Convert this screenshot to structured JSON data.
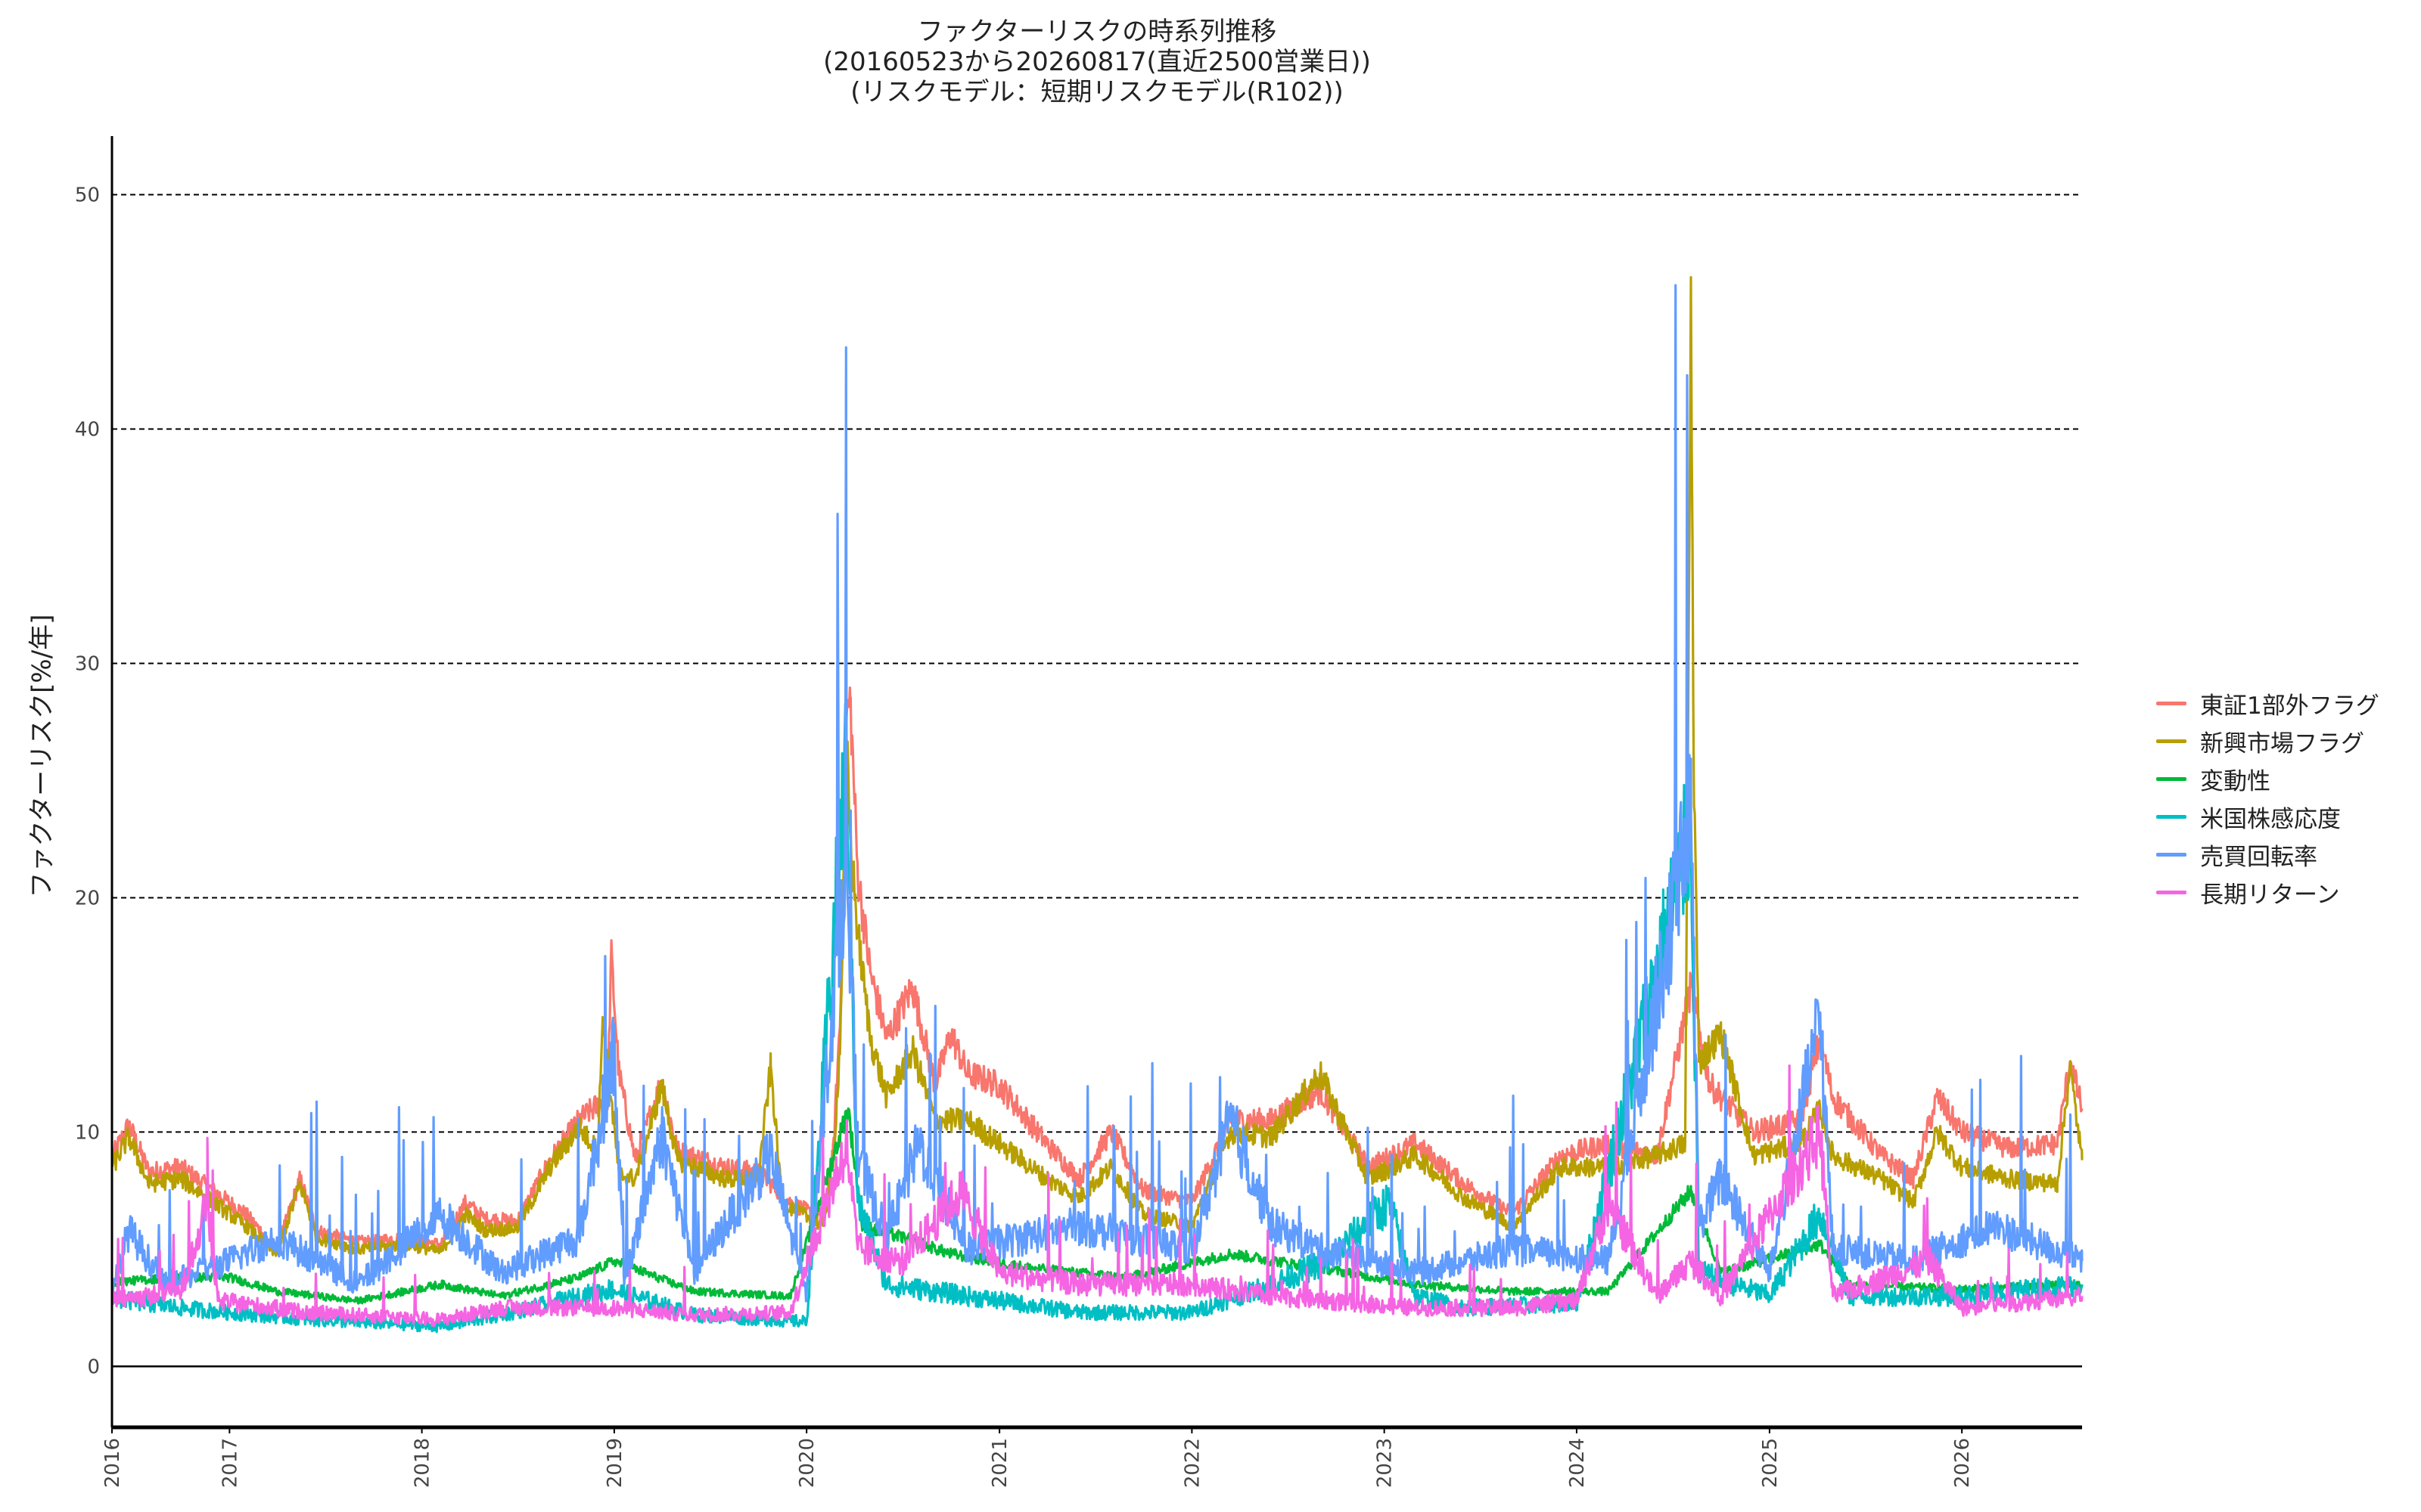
{
  "title": {
    "line1": "ファクターリスクの時系列推移",
    "line2": "(20160523から20260817(直近2500営業日))",
    "line3": "(リスクモデル：短期リスクモデル(R102))"
  },
  "chart_data": {
    "type": "line",
    "title": "ファクターリスクの時系列推移 (20160523から20260817(直近2500営業日)) (リスクモデル：短期リスクモデル(R102))",
    "xlabel": "",
    "ylabel": "ファクターリスク[%/年]",
    "xlim": [
      "2016-05-23",
      "2026-08-17"
    ],
    "ylim": [
      -2.6,
      52.5
    ],
    "yticks": [
      0,
      10,
      20,
      30,
      40,
      50
    ],
    "xticks": [
      "2016",
      "2017",
      "2018",
      "2019",
      "2020",
      "2021",
      "2022",
      "2023",
      "2024",
      "2025",
      "2026"
    ],
    "grid": "horizontal dashed",
    "legend_position": "right",
    "series": [
      {
        "name": "東証1部外フラグ",
        "color": "#F8766D",
        "points": [
          [
            "2016-05-23",
            8.9
          ],
          [
            "2016-06-24",
            10.3
          ],
          [
            "2016-08-01",
            8.3
          ],
          [
            "2016-10-01",
            8.5
          ],
          [
            "2016-12-01",
            7.5
          ],
          [
            "2017-02-01",
            6.5
          ],
          [
            "2017-04-01",
            5.0
          ],
          [
            "2017-05-15",
            8.0
          ],
          [
            "2017-06-15",
            5.8
          ],
          [
            "2017-09-01",
            5.3
          ],
          [
            "2017-12-01",
            5.5
          ],
          [
            "2018-02-06",
            5.2
          ],
          [
            "2018-03-25",
            7.0
          ],
          [
            "2018-05-01",
            6.3
          ],
          [
            "2018-07-01",
            6.2
          ],
          [
            "2018-09-01",
            8.8
          ],
          [
            "2018-10-26",
            10.5
          ],
          [
            "2018-12-20",
            11.5
          ],
          [
            "2018-12-26",
            17.6
          ],
          [
            "2019-01-10",
            12.5
          ],
          [
            "2019-02-10",
            8.8
          ],
          [
            "2019-04-01",
            12.2
          ],
          [
            "2019-05-01",
            9.2
          ],
          [
            "2019-08-01",
            8.5
          ],
          [
            "2019-10-01",
            8.3
          ],
          [
            "2019-12-01",
            7.0
          ],
          [
            "2020-02-01",
            6.3
          ],
          [
            "2020-02-20",
            9.0
          ],
          [
            "2020-03-05",
            15.0
          ],
          [
            "2020-03-17",
            27.8
          ],
          [
            "2020-03-24",
            28.4
          ],
          [
            "2020-04-07",
            21.0
          ],
          [
            "2020-05-01",
            16.8
          ],
          [
            "2020-06-01",
            14.0
          ],
          [
            "2020-07-20",
            16.2
          ],
          [
            "2020-09-01",
            12.0
          ],
          [
            "2020-10-01",
            14.2
          ],
          [
            "2020-11-01",
            12.5
          ],
          [
            "2021-01-01",
            12.0
          ],
          [
            "2021-04-01",
            9.5
          ],
          [
            "2021-06-01",
            8.0
          ],
          [
            "2021-08-01",
            10.0
          ],
          [
            "2021-10-01",
            7.5
          ],
          [
            "2022-01-01",
            7.0
          ],
          [
            "2022-03-15",
            10.5
          ],
          [
            "2022-06-01",
            10.5
          ],
          [
            "2022-09-01",
            11.8
          ],
          [
            "2022-12-01",
            8.5
          ],
          [
            "2023-03-01",
            9.5
          ],
          [
            "2023-06-01",
            7.8
          ],
          [
            "2023-09-01",
            6.5
          ],
          [
            "2023-12-01",
            9.0
          ],
          [
            "2024-03-01",
            9.5
          ],
          [
            "2024-06-01",
            9.0
          ],
          [
            "2024-08-05",
            16.2
          ],
          [
            "2024-09-10",
            12.0
          ],
          [
            "2024-12-01",
            10.0
          ],
          [
            "2025-03-01",
            10.5
          ],
          [
            "2025-04-07",
            14.0
          ],
          [
            "2025-05-01",
            11.5
          ],
          [
            "2025-08-01",
            9.0
          ],
          [
            "2025-10-01",
            8.0
          ],
          [
            "2025-11-15",
            11.5
          ],
          [
            "2026-01-01",
            10.0
          ],
          [
            "2026-04-01",
            9.3
          ],
          [
            "2026-07-01",
            9.5
          ],
          [
            "2026-07-25",
            13.0
          ],
          [
            "2026-08-17",
            11.0
          ]
        ]
      },
      {
        "name": "新興市場フラグ",
        "color": "#B79F00",
        "points": [
          [
            "2016-05-23",
            8.5
          ],
          [
            "2016-06-24",
            9.8
          ],
          [
            "2016-08-01",
            7.8
          ],
          [
            "2016-10-01",
            8.0
          ],
          [
            "2016-12-01",
            7.0
          ],
          [
            "2017-02-01",
            6.0
          ],
          [
            "2017-04-01",
            4.8
          ],
          [
            "2017-05-15",
            7.8
          ],
          [
            "2017-06-15",
            5.5
          ],
          [
            "2017-09-01",
            5.0
          ],
          [
            "2017-12-01",
            5.2
          ],
          [
            "2018-02-06",
            4.9
          ],
          [
            "2018-03-25",
            6.5
          ],
          [
            "2018-05-01",
            5.8
          ],
          [
            "2018-07-01",
            5.9
          ],
          [
            "2018-09-01",
            8.5
          ],
          [
            "2018-10-26",
            10.2
          ],
          [
            "2018-12-01",
            9.2
          ],
          [
            "2018-12-10",
            14.9
          ],
          [
            "2019-01-10",
            8.2
          ],
          [
            "2019-02-10",
            8.0
          ],
          [
            "2019-04-01",
            12.0
          ],
          [
            "2019-05-01",
            8.8
          ],
          [
            "2019-08-01",
            8.0
          ],
          [
            "2019-10-01",
            8.0
          ],
          [
            "2019-10-25",
            12.8
          ],
          [
            "2019-11-15",
            7.0
          ],
          [
            "2020-02-01",
            6.0
          ],
          [
            "2020-02-20",
            8.5
          ],
          [
            "2020-03-05",
            14.0
          ],
          [
            "2020-03-17",
            26.5
          ],
          [
            "2020-03-24",
            22.5
          ],
          [
            "2020-04-07",
            18.5
          ],
          [
            "2020-05-01",
            14.0
          ],
          [
            "2020-06-01",
            11.5
          ],
          [
            "2020-07-20",
            13.5
          ],
          [
            "2020-09-01",
            10.5
          ],
          [
            "2020-11-01",
            10.5
          ],
          [
            "2021-01-01",
            9.5
          ],
          [
            "2021-04-01",
            8.0
          ],
          [
            "2021-06-01",
            7.2
          ],
          [
            "2021-08-01",
            8.5
          ],
          [
            "2021-10-01",
            6.5
          ],
          [
            "2022-01-01",
            6.0
          ],
          [
            "2022-03-15",
            10.0
          ],
          [
            "2022-06-01",
            9.8
          ],
          [
            "2022-09-01",
            12.5
          ],
          [
            "2022-12-01",
            8.0
          ],
          [
            "2023-03-01",
            9.0
          ],
          [
            "2023-06-01",
            7.2
          ],
          [
            "2023-09-01",
            6.0
          ],
          [
            "2023-12-01",
            8.5
          ],
          [
            "2024-03-01",
            8.5
          ],
          [
            "2024-06-01",
            9.0
          ],
          [
            "2024-07-25",
            9.5
          ],
          [
            "2024-08-05",
            45.5
          ],
          [
            "2024-08-10",
            26.0
          ],
          [
            "2024-08-20",
            13.0
          ],
          [
            "2024-10-01",
            14.2
          ],
          [
            "2024-12-01",
            9.0
          ],
          [
            "2025-03-01",
            9.5
          ],
          [
            "2025-04-07",
            11.0
          ],
          [
            "2025-05-01",
            9.0
          ],
          [
            "2025-08-01",
            8.0
          ],
          [
            "2025-10-01",
            7.0
          ],
          [
            "2025-11-15",
            10.0
          ],
          [
            "2026-01-01",
            8.5
          ],
          [
            "2026-04-01",
            8.0
          ],
          [
            "2026-07-01",
            7.8
          ],
          [
            "2026-07-25",
            12.8
          ],
          [
            "2026-08-17",
            8.8
          ]
        ]
      },
      {
        "name": "変動性",
        "color": "#00BA38",
        "points": [
          [
            "2016-05-23",
            3.6
          ],
          [
            "2016-10-01",
            3.8
          ],
          [
            "2017-01-01",
            3.8
          ],
          [
            "2017-04-01",
            3.2
          ],
          [
            "2017-09-01",
            2.8
          ],
          [
            "2018-02-06",
            3.5
          ],
          [
            "2018-06-01",
            3.0
          ],
          [
            "2018-10-26",
            3.8
          ],
          [
            "2019-01-01",
            4.5
          ],
          [
            "2019-06-01",
            3.2
          ],
          [
            "2019-12-01",
            3.0
          ],
          [
            "2020-03-20",
            11.0
          ],
          [
            "2020-04-15",
            6.0
          ],
          [
            "2020-07-01",
            5.5
          ],
          [
            "2020-10-01",
            4.8
          ],
          [
            "2021-03-01",
            4.2
          ],
          [
            "2021-09-01",
            3.8
          ],
          [
            "2022-03-15",
            4.8
          ],
          [
            "2022-09-01",
            4.2
          ],
          [
            "2023-03-01",
            3.5
          ],
          [
            "2023-09-01",
            3.2
          ],
          [
            "2024-03-01",
            3.2
          ],
          [
            "2024-08-05",
            7.5
          ],
          [
            "2024-10-01",
            4.0
          ],
          [
            "2025-04-07",
            5.2
          ],
          [
            "2025-06-01",
            3.5
          ],
          [
            "2026-01-01",
            3.3
          ],
          [
            "2026-08-17",
            3.5
          ]
        ]
      },
      {
        "name": "米国株感応度",
        "color": "#00BFC4",
        "points": [
          [
            "2016-05-23",
            2.9
          ],
          [
            "2016-10-01",
            2.5
          ],
          [
            "2017-01-01",
            2.3
          ],
          [
            "2017-06-01",
            2.0
          ],
          [
            "2018-02-06",
            1.7
          ],
          [
            "2018-06-01",
            2.2
          ],
          [
            "2018-12-26",
            3.3
          ],
          [
            "2019-06-01",
            2.2
          ],
          [
            "2020-01-01",
            1.9
          ],
          [
            "2020-03-17",
            26.3
          ],
          [
            "2020-04-07",
            7.0
          ],
          [
            "2020-06-01",
            3.5
          ],
          [
            "2021-01-01",
            2.8
          ],
          [
            "2021-06-01",
            2.3
          ],
          [
            "2022-01-01",
            2.3
          ],
          [
            "2022-06-01",
            3.5
          ],
          [
            "2022-09-15",
            4.5
          ],
          [
            "2023-01-10",
            7.0
          ],
          [
            "2023-03-01",
            3.0
          ],
          [
            "2023-06-01",
            2.5
          ],
          [
            "2024-01-01",
            2.7
          ],
          [
            "2024-08-05",
            23.0
          ],
          [
            "2024-08-20",
            4.0
          ],
          [
            "2025-01-01",
            3.0
          ],
          [
            "2025-04-07",
            6.5
          ],
          [
            "2025-06-01",
            3.0
          ],
          [
            "2026-01-01",
            3.0
          ],
          [
            "2026-08-17",
            3.5
          ]
        ]
      },
      {
        "name": "売買回転率",
        "color": "#619CFF",
        "points": [
          [
            "2016-05-23",
            3.2
          ],
          [
            "2016-06-24",
            5.8
          ],
          [
            "2016-09-01",
            3.5
          ],
          [
            "2017-01-01",
            4.5
          ],
          [
            "2017-04-01",
            5.5
          ],
          [
            "2017-09-01",
            3.5
          ],
          [
            "2018-02-06",
            6.5
          ],
          [
            "2018-06-01",
            4.0
          ],
          [
            "2018-10-26",
            5.5
          ],
          [
            "2019-01-01",
            13.5
          ],
          [
            "2019-01-20",
            3.5
          ],
          [
            "2019-04-01",
            10.0
          ],
          [
            "2019-06-01",
            4.0
          ],
          [
            "2019-10-25",
            9.0
          ],
          [
            "2020-01-01",
            3.0
          ],
          [
            "2020-03-17",
            22.0
          ],
          [
            "2020-04-07",
            9.0
          ],
          [
            "2020-06-01",
            5.5
          ],
          [
            "2020-08-01",
            9.5
          ],
          [
            "2020-11-01",
            5.0
          ],
          [
            "2021-06-01",
            6.0
          ],
          [
            "2022-01-01",
            5.0
          ],
          [
            "2022-03-15",
            10.5
          ],
          [
            "2022-06-01",
            6.0
          ],
          [
            "2022-09-01",
            5.0
          ],
          [
            "2023-03-01",
            4.0
          ],
          [
            "2023-09-01",
            5.0
          ],
          [
            "2024-03-01",
            4.5
          ],
          [
            "2024-08-05",
            23.5
          ],
          [
            "2024-08-20",
            6.0
          ],
          [
            "2024-10-01",
            8.0
          ],
          [
            "2025-01-01",
            4.0
          ],
          [
            "2025-04-07",
            15.0
          ],
          [
            "2025-05-01",
            5.0
          ],
          [
            "2025-10-01",
            4.5
          ],
          [
            "2026-03-01",
            6.0
          ],
          [
            "2026-08-17",
            4.5
          ]
        ]
      },
      {
        "name": "長期リターン",
        "color": "#F564E3",
        "points": [
          [
            "2016-05-23",
            2.8
          ],
          [
            "2016-10-01",
            3.2
          ],
          [
            "2016-11-20",
            7.0
          ],
          [
            "2016-12-10",
            2.8
          ],
          [
            "2017-06-01",
            2.3
          ],
          [
            "2018-02-06",
            2.0
          ],
          [
            "2018-06-01",
            2.5
          ],
          [
            "2018-12-26",
            2.5
          ],
          [
            "2019-06-01",
            2.2
          ],
          [
            "2019-12-01",
            2.3
          ],
          [
            "2020-03-17",
            9.5
          ],
          [
            "2020-04-07",
            5.0
          ],
          [
            "2020-07-01",
            4.5
          ],
          [
            "2020-10-20",
            7.5
          ],
          [
            "2021-01-01",
            4.0
          ],
          [
            "2021-06-01",
            3.5
          ],
          [
            "2022-01-01",
            3.5
          ],
          [
            "2022-06-01",
            3.0
          ],
          [
            "2023-03-01",
            2.5
          ],
          [
            "2023-09-01",
            2.5
          ],
          [
            "2024-01-01",
            2.8
          ],
          [
            "2024-03-01",
            7.0
          ],
          [
            "2024-06-01",
            3.0
          ],
          [
            "2024-08-05",
            4.5
          ],
          [
            "2024-10-01",
            3.0
          ],
          [
            "2025-04-07",
            10.0
          ],
          [
            "2025-05-01",
            3.0
          ],
          [
            "2025-11-01",
            4.5
          ],
          [
            "2026-01-01",
            2.5
          ],
          [
            "2026-08-17",
            3.0
          ]
        ]
      }
    ]
  }
}
